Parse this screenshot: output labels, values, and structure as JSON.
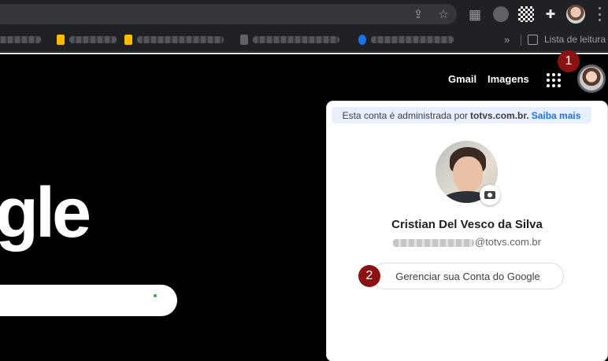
{
  "browser": {
    "bookmarks_overflow": "»",
    "reading_list_label": "Lista de leitura"
  },
  "google": {
    "nav_gmail": "Gmail",
    "nav_images": "Imagens",
    "logo_fragment": "gle"
  },
  "steps": {
    "step1": "1",
    "step2": "2"
  },
  "account_popup": {
    "admin_text": "Esta conta é administrada por",
    "admin_domain": "totvs.com.br.",
    "admin_link": "Saiba mais",
    "user_name": "Cristian Del Vesco da Silva",
    "email_suffix": "@totvs.com.br",
    "manage_button": "Gerenciar sua Conta do Google"
  },
  "colors": {
    "step_badge": "#8a1212",
    "link_blue": "#1a73e8",
    "admin_bar_bg": "#e8f0fe"
  }
}
